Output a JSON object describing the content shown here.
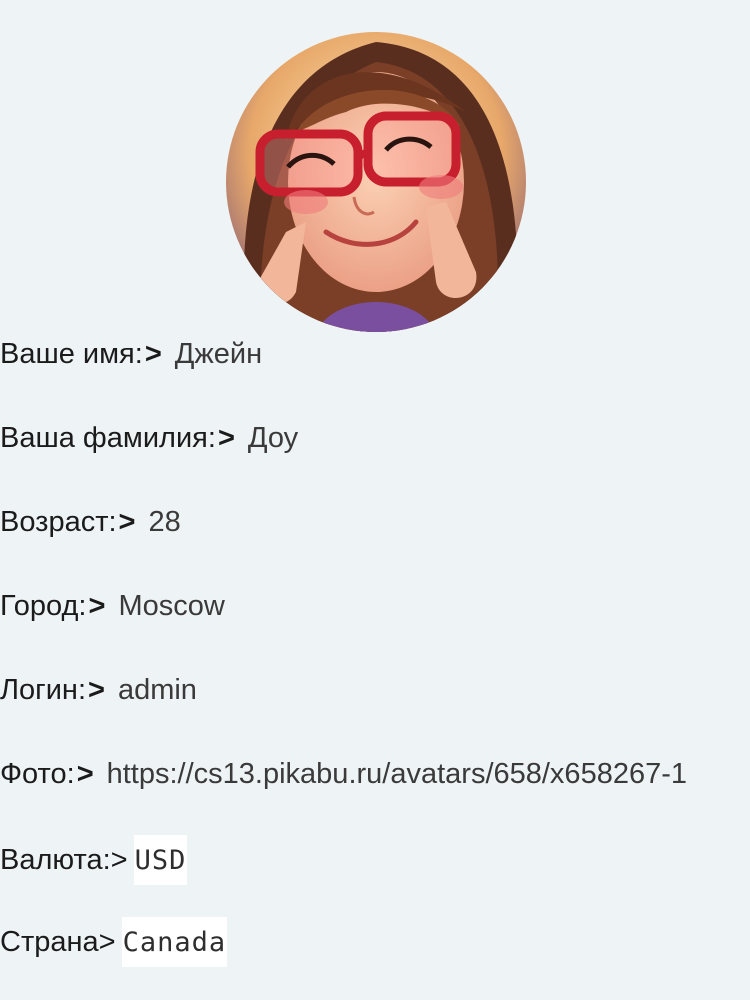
{
  "profile": {
    "fields": [
      {
        "label": "Ваше имя:",
        "arrow": ">",
        "value": "Джейн"
      },
      {
        "label": "Ваша фамилия:",
        "arrow": ">",
        "value": "Доу"
      },
      {
        "label": "Возраст:",
        "arrow": ">",
        "value": "28"
      },
      {
        "label": "Город:",
        "arrow": ">",
        "value": "Moscow"
      },
      {
        "label": "Логин:",
        "arrow": ">",
        "value": "admin"
      },
      {
        "label": "Фото:",
        "arrow": ">",
        "value": "https://cs13.pikabu.ru/avatars/658/x658267-1"
      }
    ],
    "currency": {
      "label": "Валюта:>",
      "selected": "USD"
    },
    "country": {
      "label": "Страна>",
      "selected": "Canada"
    }
  }
}
